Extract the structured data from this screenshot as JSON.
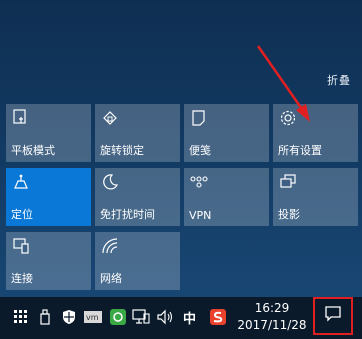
{
  "action_center": {
    "collapse_label": "折叠",
    "tiles": [
      {
        "label": "平板模式",
        "icon": "tablet-mode-icon",
        "active": false
      },
      {
        "label": "旋转锁定",
        "icon": "rotation-lock-icon",
        "active": false
      },
      {
        "label": "便笺",
        "icon": "note-icon",
        "active": false
      },
      {
        "label": "所有设置",
        "icon": "gear-icon",
        "active": false
      },
      {
        "label": "定位",
        "icon": "location-icon",
        "active": true
      },
      {
        "label": "免打扰时间",
        "icon": "moon-icon",
        "active": false
      },
      {
        "label": "VPN",
        "icon": "vpn-icon",
        "active": false
      },
      {
        "label": "投影",
        "icon": "project-icon",
        "active": false
      },
      {
        "label": "连接",
        "icon": "connect-icon",
        "active": false
      },
      {
        "label": "网络",
        "icon": "network-icon",
        "active": false
      }
    ]
  },
  "taskbar": {
    "ime_label": "中",
    "time": "16:29",
    "date": "2017/11/28",
    "tray_icons": [
      "tray-overflow-grid-icon",
      "usb-icon",
      "shield-icon",
      "vm-icon",
      "green-app-icon",
      "network-monitor-icon",
      "volume-icon",
      "sogou-icon"
    ]
  },
  "colors": {
    "active_tile": "#0a78d7",
    "highlight_box": "#e02020",
    "arrow": "#e02020"
  }
}
